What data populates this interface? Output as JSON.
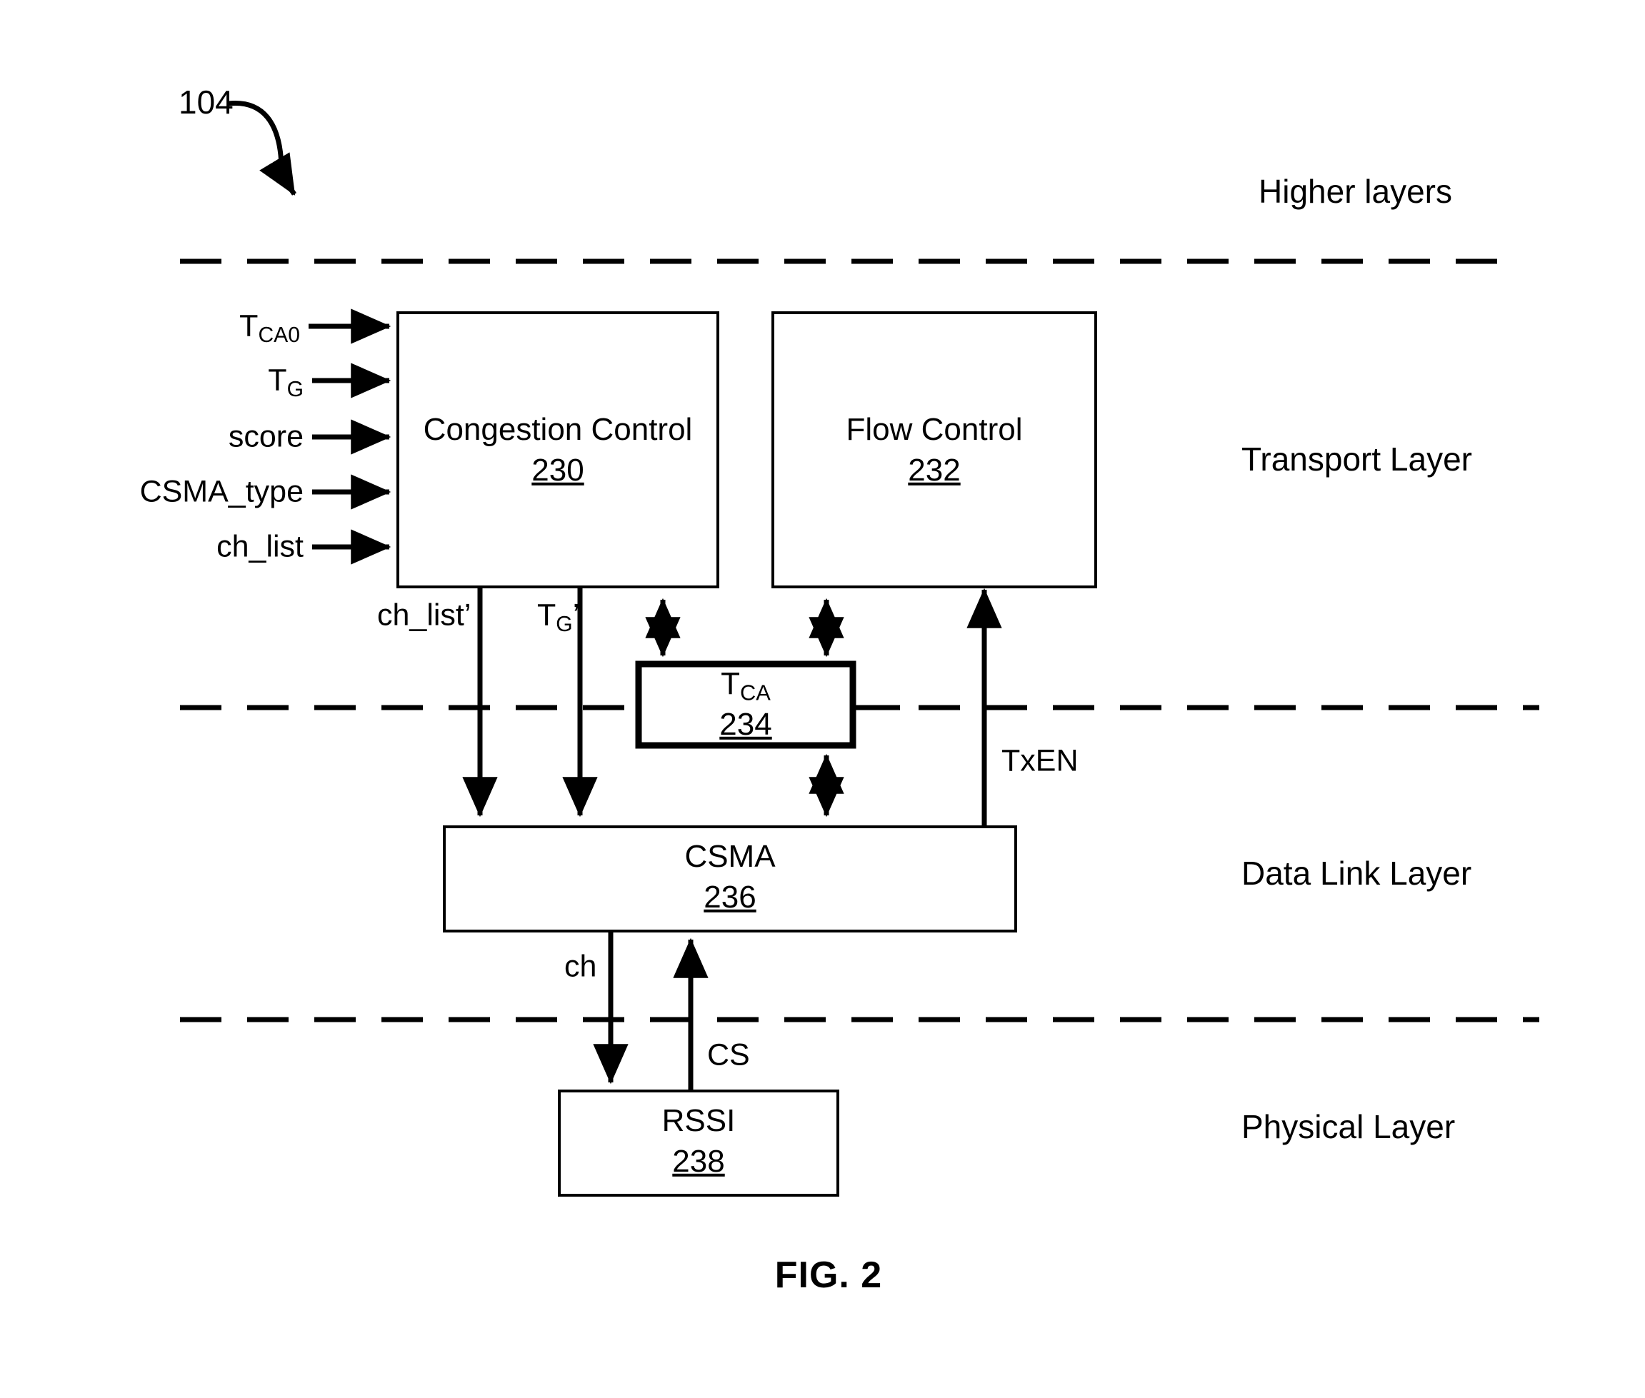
{
  "figure": {
    "caption": "FIG. 2",
    "reference_numeral": "104"
  },
  "layers": [
    {
      "name": "higher",
      "label": "Higher layers"
    },
    {
      "name": "transport",
      "label": "Transport Layer"
    },
    {
      "name": "datalink",
      "label": "Data Link Layer"
    },
    {
      "name": "physical",
      "label": "Physical Layer"
    }
  ],
  "inputs": [
    {
      "id": "tca0",
      "base": "T",
      "sub": "CA0",
      "prime": ""
    },
    {
      "id": "tg",
      "base": "T",
      "sub": "G",
      "prime": ""
    },
    {
      "id": "score",
      "base": "score",
      "sub": "",
      "prime": ""
    },
    {
      "id": "csma_type",
      "base": "CSMA_type",
      "sub": "",
      "prime": ""
    },
    {
      "id": "ch_list",
      "base": "ch_list",
      "sub": "",
      "prime": ""
    }
  ],
  "blocks": [
    {
      "id": "congestion_control",
      "title": "Congestion Control",
      "number": "230"
    },
    {
      "id": "flow_control",
      "title": "Flow Control",
      "number": "232"
    },
    {
      "id": "tca",
      "title": "T",
      "title_sub": "CA",
      "number": "234"
    },
    {
      "id": "csma",
      "title": "CSMA",
      "number": "236"
    },
    {
      "id": "rssi",
      "title": "RSSI",
      "number": "238"
    }
  ],
  "signals": [
    {
      "id": "ch_list_prime",
      "base": "ch_list",
      "sub": "",
      "prime": "’"
    },
    {
      "id": "tg_prime",
      "base": "T",
      "sub": "G",
      "prime": "’"
    },
    {
      "id": "txen",
      "base": "TxEN",
      "sub": "",
      "prime": ""
    },
    {
      "id": "ch",
      "base": "ch",
      "sub": "",
      "prime": ""
    },
    {
      "id": "cs",
      "base": "CS",
      "sub": "",
      "prime": ""
    }
  ],
  "colors": {
    "stroke": "#000000",
    "background": "#ffffff"
  }
}
